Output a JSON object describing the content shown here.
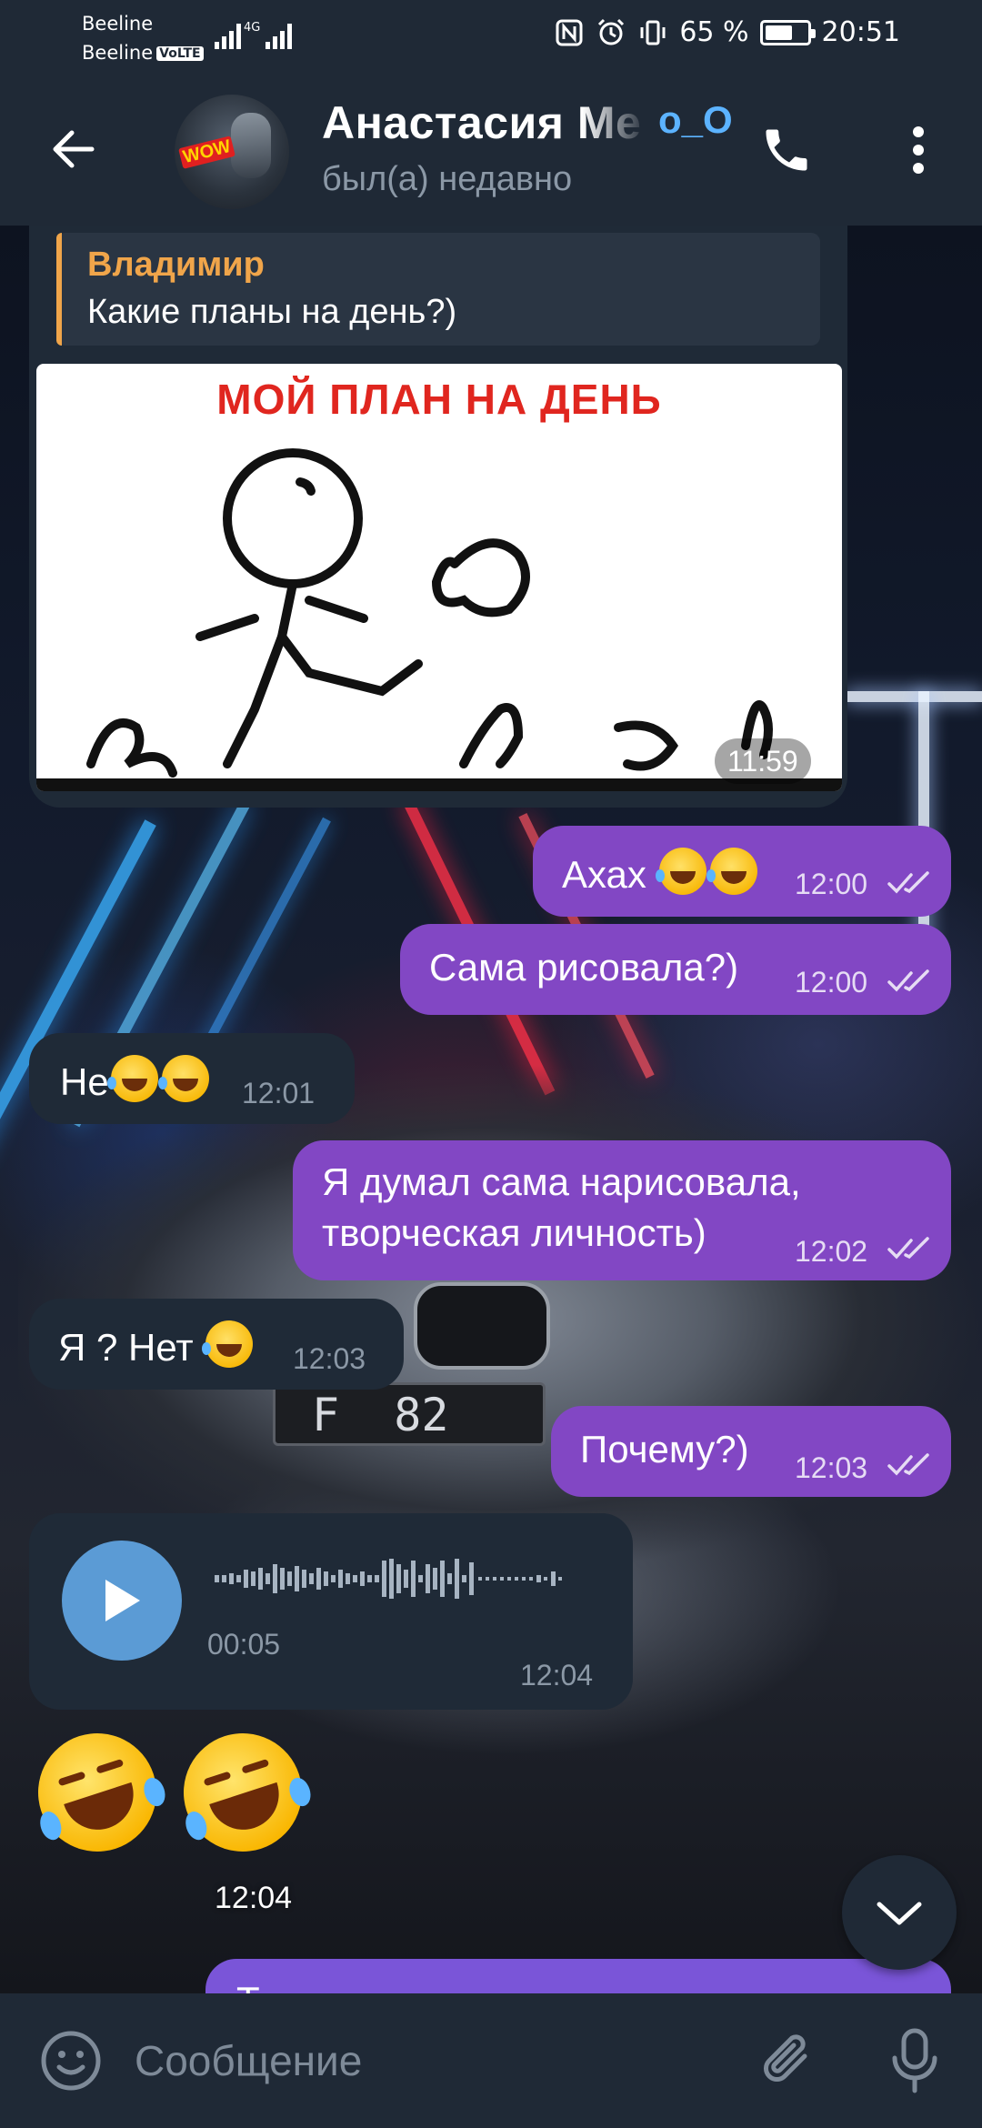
{
  "status_bar": {
    "carrier1": "Beeline",
    "carrier2": "Beeline",
    "volte": "VoLTE",
    "network": "4G",
    "battery_pct": "65 %",
    "battery_level": 0.65,
    "time": "20:51"
  },
  "header": {
    "name": "Анастасия Ме",
    "name_emoji": "o_O",
    "status": "был(а) недавно"
  },
  "messages": {
    "photo_msg": {
      "reply_author": "Владимир",
      "reply_text": "Какие планы на день?)",
      "image_caption": "МОЙ ПЛАН НА ДЕНЬ",
      "time": "11:59"
    },
    "m1": {
      "text": "Ахах",
      "time": "12:00"
    },
    "m2": {
      "text": "Сама рисовала?)",
      "time": "12:00"
    },
    "m3": {
      "text": "Не",
      "time": "12:01"
    },
    "m4": {
      "line1": "Я думал сама нарисовала,",
      "line2": "творческая личность)",
      "time": "12:02"
    },
    "m5": {
      "text": "Я ? Нет",
      "time": "12:03"
    },
    "m6": {
      "text": "Почему?)",
      "time": "12:03"
    },
    "voice": {
      "duration": "00:05",
      "time": "12:04"
    },
    "sticker_time": "12:04",
    "partial": "Т"
  },
  "input": {
    "placeholder": "Сообщение"
  },
  "colors": {
    "header_bg": "#1f2936",
    "incoming_bubble": "#1f2a37",
    "outgoing_bubble": "#8247c4",
    "reply_accent": "#f0a54a",
    "play_button": "#5b9bd5"
  }
}
